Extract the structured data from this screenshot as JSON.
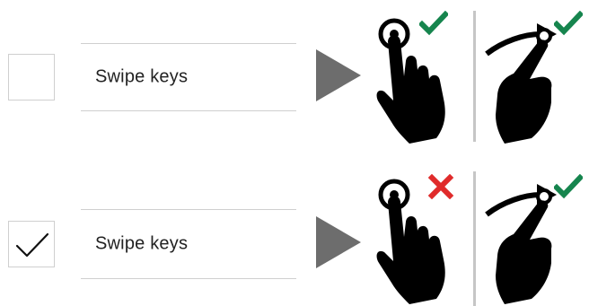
{
  "rows": [
    {
      "checkbox_checked": false,
      "label": "Swipe keys",
      "tap_gesture": {
        "icon": "tap-hand-icon",
        "status_icon": "check-icon",
        "status_color": "#16854e"
      },
      "swipe_gesture": {
        "icon": "swipe-hand-icon",
        "status_icon": "check-icon",
        "status_color": "#16854e"
      }
    },
    {
      "checkbox_checked": true,
      "label": "Swipe keys",
      "tap_gesture": {
        "icon": "tap-hand-icon",
        "status_icon": "cross-icon",
        "status_color": "#e02b2b"
      },
      "swipe_gesture": {
        "icon": "swipe-hand-icon",
        "status_icon": "check-icon",
        "status_color": "#16854e"
      }
    }
  ],
  "colors": {
    "border": "#cfcfcf",
    "arrow": "#6d6d6d",
    "divider": "#c6c6c6",
    "hand": "#000000",
    "enabled": "#16854e",
    "disabled": "#e02b2b"
  }
}
